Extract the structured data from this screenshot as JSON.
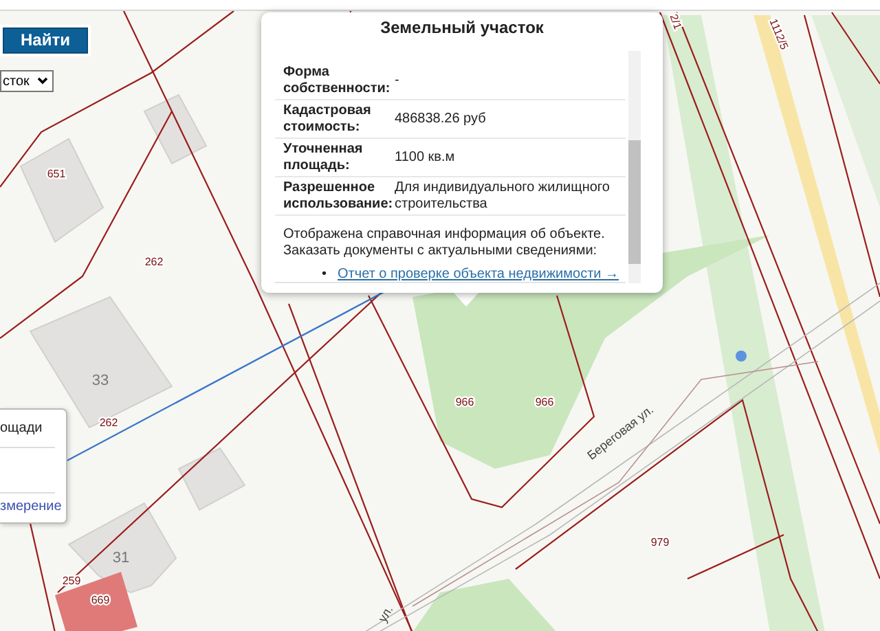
{
  "search": {
    "button": "Найти",
    "select_value": "сток"
  },
  "popup": {
    "title": "Земельный участок",
    "rows": [
      {
        "label": "Форма собственности:",
        "value": "-"
      },
      {
        "label": "Кадастровая стоимость:",
        "value": "486838.26 руб"
      },
      {
        "label": "Уточненная площадь:",
        "value": "1100 кв.м"
      },
      {
        "label": "Разрешенное использование:",
        "value": "Для индивидуального жилищного строительства"
      }
    ],
    "notes": [
      "Отображена справочная информация об объекте.",
      "Заказать документы с актуальными сведениями:"
    ],
    "links": [
      {
        "marker": "•",
        "text": "Отчет о проверке объекта недвижимости →"
      }
    ]
  },
  "side_panel": {
    "title": "ощади",
    "link": "змерение"
  },
  "map": {
    "labels": [
      {
        "text": "651",
        "kind": "parcel"
      },
      {
        "text": "262",
        "kind": "parcel"
      },
      {
        "text": "33",
        "kind": "house"
      },
      {
        "text": "262",
        "kind": "parcel"
      },
      {
        "text": "966",
        "kind": "parcel"
      },
      {
        "text": "966",
        "kind": "parcel"
      },
      {
        "text": "979",
        "kind": "parcel"
      },
      {
        "text": "31",
        "kind": "house"
      },
      {
        "text": "259",
        "kind": "parcel"
      },
      {
        "text": "669",
        "kind": "parcel"
      },
      {
        "text": "2/1",
        "kind": "parcel"
      },
      {
        "text": "1112/5",
        "kind": "parcel"
      }
    ],
    "streets": [
      "Береговая ул.",
      "ул."
    ]
  }
}
